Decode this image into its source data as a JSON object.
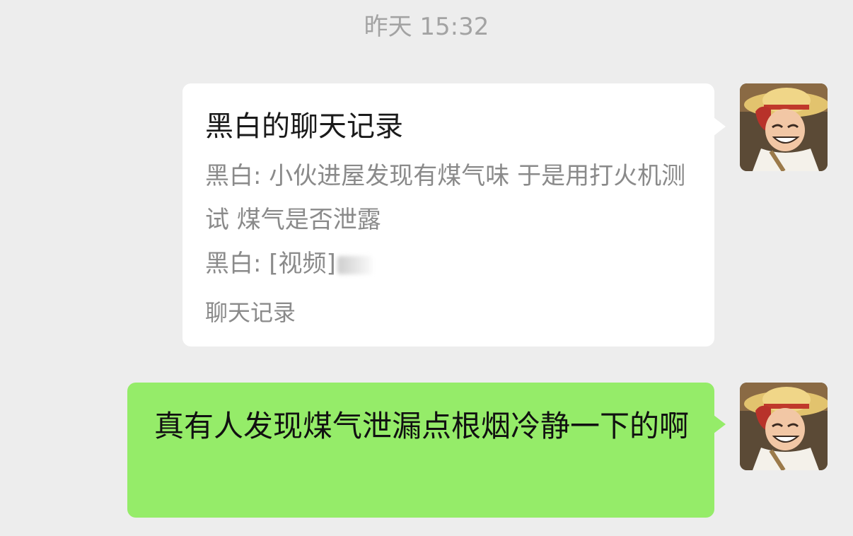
{
  "timestamp": "昨天 15:32",
  "messages": [
    {
      "type": "chat_history_card",
      "title": "黑白的聊天记录",
      "lines": [
        "黑白: 小伙进屋发现有煤气味 于是用打火机测试 煤气是否泄露",
        "黑白: [视频]"
      ],
      "footer": "聊天记录",
      "avatar": "avatar-straw-hat-icon"
    },
    {
      "type": "text",
      "text": "真有人发现煤气泄漏点根烟冷静一下的啊",
      "avatar": "avatar-straw-hat-icon"
    }
  ],
  "colors": {
    "background": "#ededed",
    "outgoing_bubble": "#95ec69",
    "card_bubble": "#ffffff",
    "timestamp_text": "#a3a3a3",
    "secondary_text": "#8a8a8a"
  }
}
